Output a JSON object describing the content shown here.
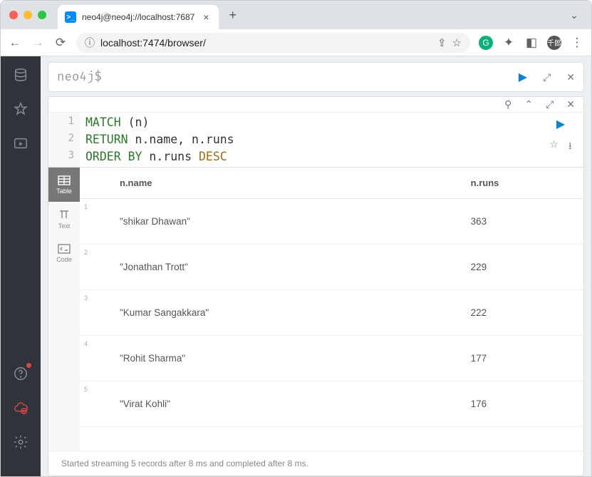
{
  "browser": {
    "tab_title": "neo4j@neo4j://localhost:7687",
    "url": "localhost:7474/browser/"
  },
  "editor": {
    "prompt": "neo4j$",
    "lines": [
      {
        "n": "1",
        "tokens": [
          [
            "kw",
            "MATCH "
          ],
          [
            "",
            ""
          ],
          [
            "",
            "(n)"
          ]
        ]
      },
      {
        "n": "2",
        "tokens": [
          [
            "kw",
            "RETURN "
          ],
          [
            "",
            "n.name, n.runs"
          ]
        ]
      },
      {
        "n": "3",
        "tokens": [
          [
            "kw",
            "ORDER BY "
          ],
          [
            "",
            "n.runs "
          ],
          [
            "fn",
            "DESC"
          ]
        ]
      }
    ]
  },
  "view_tabs": {
    "table": "Table",
    "text": "Text",
    "code": "Code"
  },
  "table": {
    "headers": [
      "n.name",
      "n.runs"
    ],
    "rows": [
      {
        "idx": "1",
        "name": "\"shikar Dhawan\"",
        "runs": "363"
      },
      {
        "idx": "2",
        "name": "\"Jonathan Trott\"",
        "runs": "229"
      },
      {
        "idx": "3",
        "name": "\"Kumar Sangakkara\"",
        "runs": "222"
      },
      {
        "idx": "4",
        "name": "\"Rohit Sharma\"",
        "runs": "177"
      },
      {
        "idx": "5",
        "name": "\"Virat Kohli\"",
        "runs": "176"
      }
    ]
  },
  "status": "Started streaming 5 records after 8 ms and completed after 8 ms."
}
